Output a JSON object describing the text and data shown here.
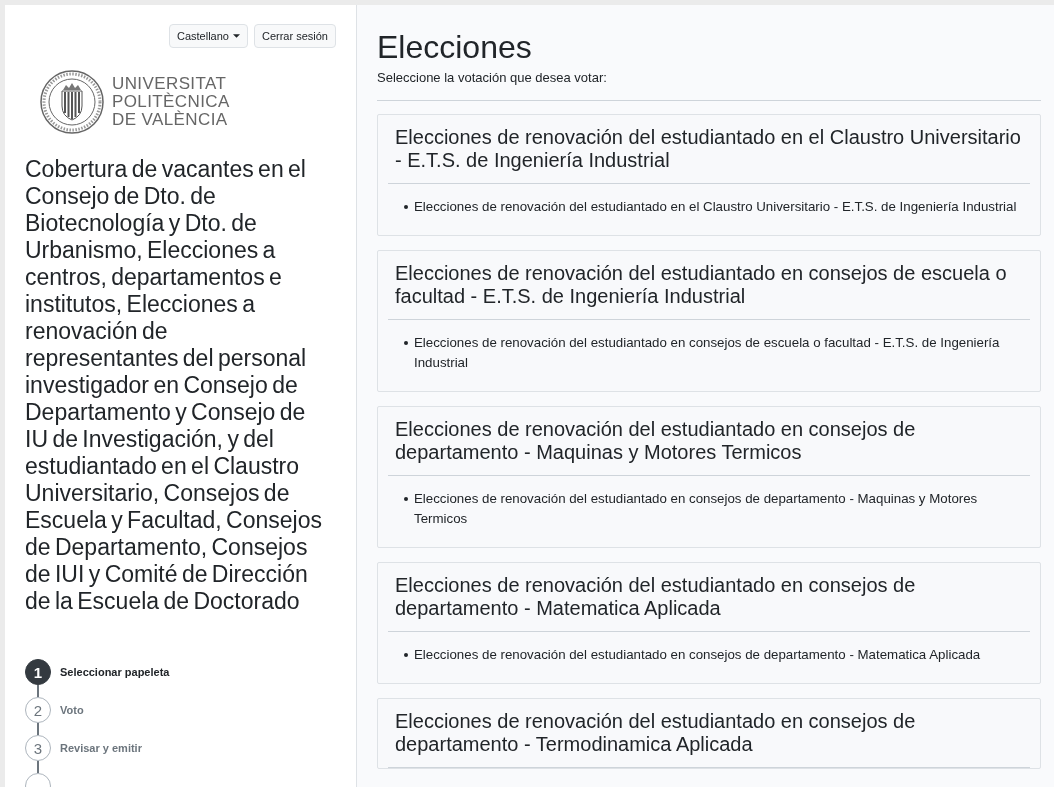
{
  "header": {
    "language_menu": "Castellano",
    "logout_button": "Cerrar sesión"
  },
  "logo": {
    "lines": [
      "UNIVERSITAT",
      "POLITÈCNICA",
      "DE VALÈNCIA"
    ]
  },
  "process_title": "Cobertura de vacantes en el Consejo de Dto. de Biotecnología y Dto. de Urbanismo, Elecciones a centros, departamentos e institutos, Elecciones a renovación de representantes del personal investigador en Consejo de Departamento y Consejo de IU de Investigación, y del estudiantado en el Claustro Universitario, Consejos de Escuela y Facultad, Consejos de Departamento, Consejos de IUI y Comité de Dirección de la Escuela de Doctorado",
  "steps": [
    {
      "number": "1",
      "label": "Seleccionar papeleta",
      "current": true
    },
    {
      "number": "2",
      "label": "Voto",
      "current": false
    },
    {
      "number": "3",
      "label": "Revisar y emitir",
      "current": false
    },
    {
      "current": false
    }
  ],
  "main": {
    "title": "Elecciones",
    "instruction": "Seleccione la votación que desea votar:"
  },
  "elections": [
    {
      "title": "Elecciones de renovación del estudiantado en el Claustro Universitario - E.T.S. de Ingeniería Industrial",
      "items": [
        "Elecciones de renovación del estudiantado en el Claustro Universitario - E.T.S. de Ingeniería Industrial"
      ]
    },
    {
      "title": "Elecciones de renovación del estudiantado en consejos de escuela o facultad - E.T.S. de Ingeniería Industrial",
      "items": [
        "Elecciones de renovación del estudiantado en consejos de escuela o facultad - E.T.S. de Ingeniería Industrial"
      ]
    },
    {
      "title": "Elecciones de renovación del estudiantado en consejos de departamento - Maquinas y Motores Termicos",
      "items": [
        "Elecciones de renovación del estudiantado en consejos de departamento - Maquinas y Motores Termicos"
      ]
    },
    {
      "title": "Elecciones de renovación del estudiantado en consejos de departamento - Matematica Aplicada",
      "items": [
        "Elecciones de renovación del estudiantado en consejos de departamento - Matematica Aplicada"
      ]
    },
    {
      "title": "Elecciones de renovación del estudiantado en consejos de departamento - Termodinamica Aplicada"
    }
  ]
}
